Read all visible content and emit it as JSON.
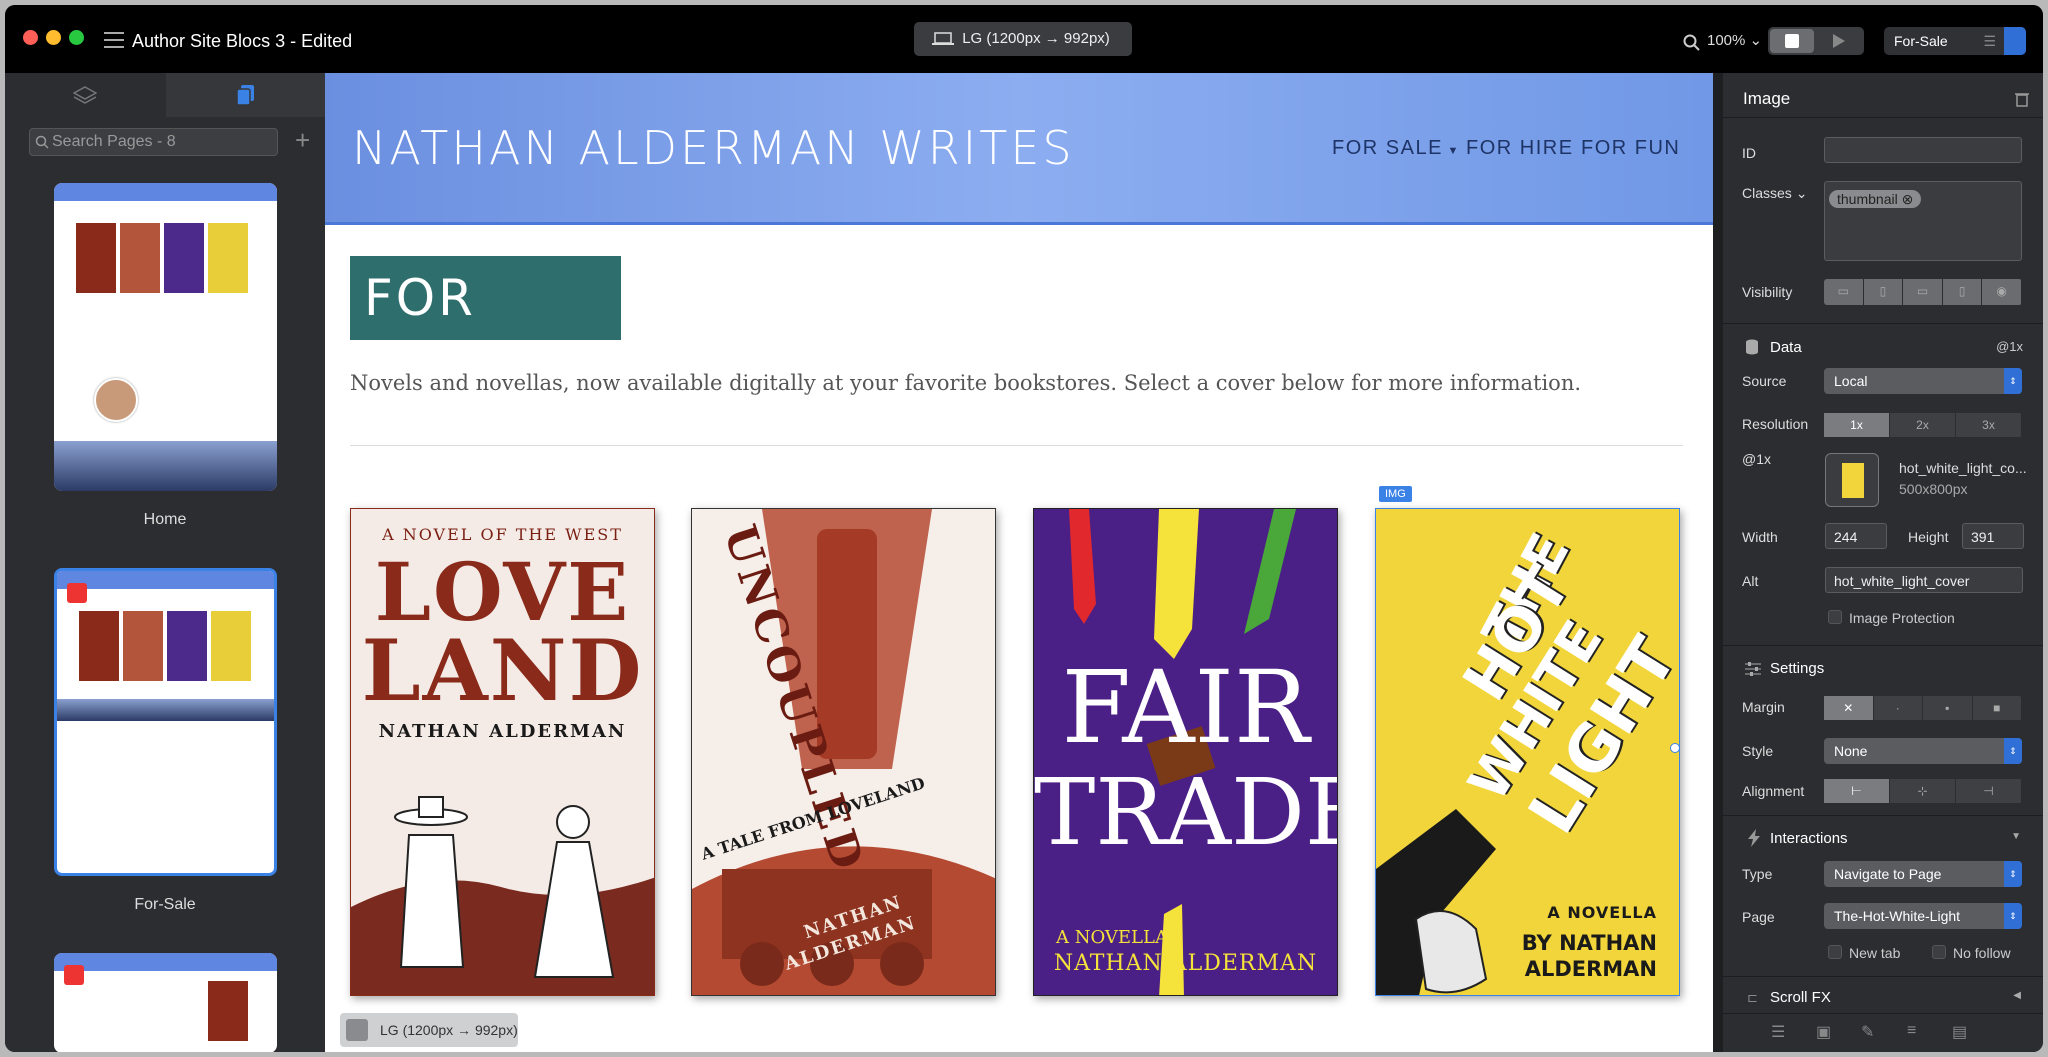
{
  "window": {
    "title": "Author Site Blocs 3 - Edited",
    "breakpoint": "LG (1200px → 992px)",
    "zoom": "100%",
    "page_selector": "For-Sale"
  },
  "left_panel": {
    "search_placeholder": "Search Pages - 8",
    "pages": [
      {
        "label": "Home"
      },
      {
        "label": "For-Sale"
      }
    ]
  },
  "site": {
    "title": "NATHAN ALDERMAN WRITES",
    "nav": [
      "FOR SALE",
      "FOR HIRE",
      "FOR FUN"
    ],
    "heading": "FOR SALE",
    "tagline": "Novels and novellas, now available digitally at your favorite bookstores. Select a cover below for more information.",
    "img_tag": "IMG",
    "breakpoint_float": "LG (1200px → 992px)",
    "covers": [
      {
        "top": "A NOVEL OF THE WEST",
        "title1": "LOVE",
        "title2": "LAND",
        "author": "NATHAN ALDERMAN"
      },
      {
        "title": "UNCOUPLED",
        "sub": "A TALE FROM LOVELAND",
        "author1": "NATHAN",
        "author2": "ALDERMAN"
      },
      {
        "title1": "FAIR",
        "title2": "TRADE",
        "sub": "A NOVELLA",
        "author": "NATHAN ALDERMAN"
      },
      {
        "title1": "THE",
        "title2": "HOT",
        "title3": "WHITE",
        "title4": "LIGHT",
        "sub": "A NOVELLA",
        "author1": "BY NATHAN",
        "author2": "ALDERMAN"
      }
    ]
  },
  "inspector": {
    "title": "Image",
    "id_label": "ID",
    "classes_label": "Classes",
    "class_tag": "thumbnail",
    "visibility_label": "Visibility",
    "data_label": "Data",
    "data_scale": "@1x",
    "source_label": "Source",
    "source_value": "Local",
    "resolution_label": "Resolution",
    "resolutions": [
      "1x",
      "2x",
      "3x"
    ],
    "at1x_label": "@1x",
    "file_name": "hot_white_light_co...",
    "file_size": "500x800px",
    "width_label": "Width",
    "width_value": "244",
    "height_label": "Height",
    "height_value": "391",
    "alt_label": "Alt",
    "alt_value": "hot_white_light_cover",
    "image_protection": "Image Protection",
    "settings_label": "Settings",
    "margin_label": "Margin",
    "style_label": "Style",
    "style_value": "None",
    "alignment_label": "Alignment",
    "interactions_label": "Interactions",
    "type_label": "Type",
    "type_value": "Navigate to Page",
    "page_label": "Page",
    "page_value": "The-Hot-White-Light",
    "new_tab": "New tab",
    "no_follow": "No follow",
    "scroll_fx": "Scroll FX"
  }
}
